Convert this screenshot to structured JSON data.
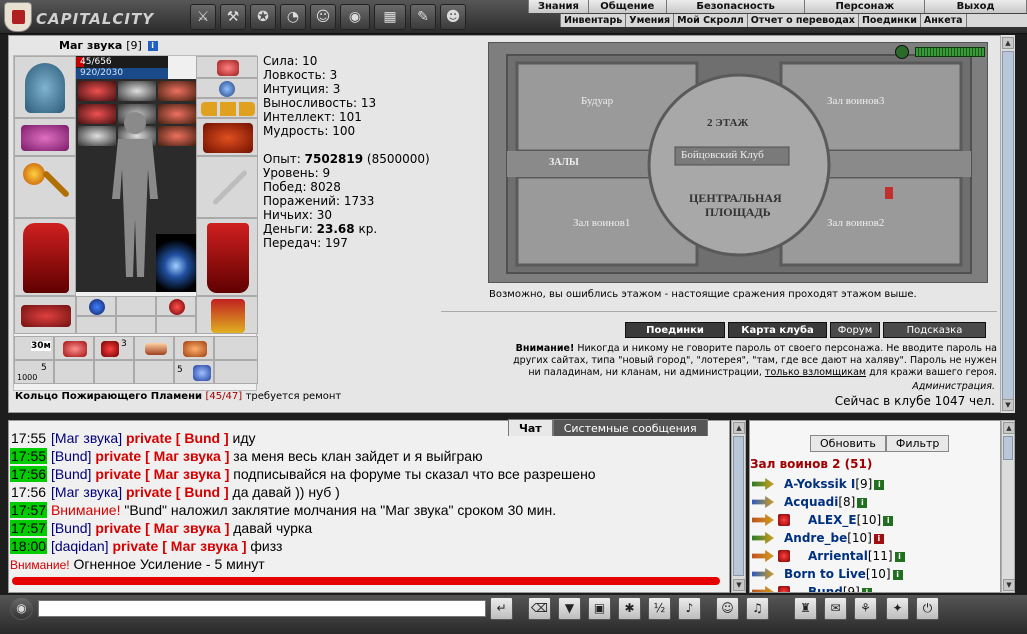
{
  "app": {
    "name": "CAPITALCITY"
  },
  "top_icons": [
    "crossed-swords-icon",
    "tools-icon",
    "badge-icon",
    "clock-icon",
    "smiley-icon",
    "eye-icon",
    "map-icon",
    "pencil-icon",
    "smile-icon"
  ],
  "menu_main": [
    "Знания",
    "Общение",
    "Безопасность",
    "Персонаж",
    "Выход"
  ],
  "menu_sub": [
    "Инвентарь",
    "Умения",
    "Мой Скролл",
    "Отчет о переводах",
    "Поединки",
    "Анкета"
  ],
  "character": {
    "name": "Маг звука",
    "level": "[9]",
    "info": "i",
    "hp": "45/656",
    "mp": "920/2030",
    "ring_name": "Кольцо Пожирающего Пламени",
    "ring_durability": "[45/47]",
    "ring_note": "требуется ремонт",
    "slot_labels": {
      "s1": "30м",
      "s2": "3",
      "s3": "5",
      "s4": "5",
      "s5": "1000"
    }
  },
  "stats": [
    {
      "label": "Сила:",
      "value": "10"
    },
    {
      "label": "Ловкость:",
      "value": "3"
    },
    {
      "label": "Интуиция:",
      "value": "3"
    },
    {
      "label": "Выносливость:",
      "value": "13"
    },
    {
      "label": "Интеллект:",
      "value": "101"
    },
    {
      "label": "Мудрость:",
      "value": "100"
    }
  ],
  "stats2": {
    "exp_label": "Опыт:",
    "exp": "7502819",
    "exp_next": "(8500000)",
    "level": "Уровень: 9",
    "wins": "Побед: 8028",
    "losses": "Поражений: 1733",
    "draws": "Ничьих: 30",
    "money_label": "Деньги:",
    "money": "23.68",
    "money_unit": "кр.",
    "transfers": "Передач: 197"
  },
  "map": {
    "rooms": {
      "boudoir": "Будуар",
      "hall3": "Зал воинов3",
      "floor": "2 ЭТАЖ",
      "club": "Бойцовский Клуб",
      "halls": "ЗАЛЫ",
      "center1": "ЦЕНТРАЛЬНАЯ",
      "center2": "ПЛОЩАДЬ",
      "hall1": "Зал воинов1",
      "hall2": "Зал воинов2"
    },
    "note": "Возможно, вы ошиблись этажом - настоящие сражения проходят этажом выше."
  },
  "club_buttons": [
    "Поединки",
    "Карта клуба",
    "Форум",
    "Подсказка"
  ],
  "warning": {
    "bold": "Внимание!",
    "line1": " Никогда и никому не говорите пароль от своего персонажа. Не вводите пароль на",
    "line2": "других сайтах, типа \"новый город\", \"лотерея\", \"там, где все дают на халяву\". Пароль не нужен",
    "line3a": "ни паладинам, ни кланам, ни администрации, ",
    "line3link": "только взломщикам",
    "line3b": " для кражи вашего героя."
  },
  "admin": "Администрация.",
  "online": "Сейчас в клубе 1047 чел.",
  "chat_tabs": [
    "Чат",
    "Системные сообщения"
  ],
  "chat": [
    {
      "time": "17:55",
      "hl": false,
      "from": "[Маг звука]",
      "priv": "private [ Bund ]",
      "text": " иду"
    },
    {
      "time": "17:55",
      "hl": true,
      "from": "[Bund]",
      "priv": "private [ Маг звука ]",
      "text": " за меня весь клан зайдет и я выйграю"
    },
    {
      "time": "17:56",
      "hl": true,
      "from": "[Bund]",
      "priv": "private [ Маг звука ]",
      "text": " подписывайся на форуме ты сказал что все разрешено"
    },
    {
      "time": "17:56",
      "hl": false,
      "from": "[Маг звука]",
      "priv": "private [ Bund ]",
      "text": " да давай )) нуб )"
    },
    {
      "time": "17:57",
      "hl": true,
      "warn": "Внимание!",
      "text": " \"Bund\" наложил заклятие молчания на \"Маг звука\" сроком 30 мин."
    },
    {
      "time": "17:57",
      "hl": true,
      "from": "[Bund]",
      "priv": "private [ Маг звука ]",
      "text": " давай чурка"
    },
    {
      "time": "18:00",
      "hl": true,
      "from": "[daqidan]",
      "priv": "private [ Маг звука ]",
      "text": " физз"
    },
    {
      "time": "",
      "hl": false,
      "warn2": "Внимание!",
      "text": " Огненное Усиление - 5 минут"
    }
  ],
  "room_buttons": [
    "Обновить",
    "Фильтр"
  ],
  "room_title": "Зал воинов 2 (51)",
  "players": [
    {
      "name": "A-Yokssik I",
      "level": "[9]"
    },
    {
      "name": "Acquadi",
      "level": "[8]"
    },
    {
      "name": "ALEX_E",
      "level": "[10]"
    },
    {
      "name": "Andre_be",
      "level": "[10]"
    },
    {
      "name": "Arriental",
      "level": "[11]"
    },
    {
      "name": "Born to Live",
      "level": "[10]"
    },
    {
      "name": "Bund",
      "level": "[9]"
    }
  ],
  "colors": {
    "accent_red": "#d60000",
    "name_blue": "#00007a",
    "time_green": "#00cc00"
  }
}
